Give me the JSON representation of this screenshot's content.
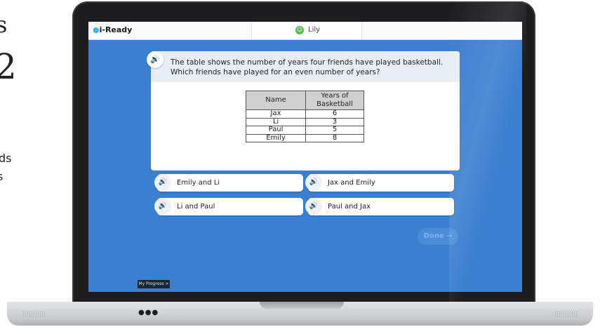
{
  "background_fragments": [
    "s",
    "2",
    "ds",
    "s"
  ],
  "topbar": {
    "logo": "i-Ready",
    "user_name": "Lily"
  },
  "question": {
    "text": "The table shows the number of years four friends have played basketball. Which friends have played for an even number of years?",
    "table": {
      "headers": [
        "Name",
        "Years of Basketball"
      ],
      "rows": [
        [
          "Jax",
          "6"
        ],
        [
          "Li",
          "3"
        ],
        [
          "Paul",
          "5"
        ],
        [
          "Emily",
          "8"
        ]
      ]
    }
  },
  "answers": [
    {
      "label": "Emily and Li"
    },
    {
      "label": "Jax and Emily"
    },
    {
      "label": "Li and Paul"
    },
    {
      "label": "Paul and Jax"
    }
  ],
  "done_label": "Done →",
  "progress_label": "My Progress >",
  "icons": {
    "speaker": "speaker-icon",
    "avatar": "smiley-icon"
  },
  "colors": {
    "screen_background": "#3a7fd0",
    "accent_green": "#4dbb45"
  }
}
